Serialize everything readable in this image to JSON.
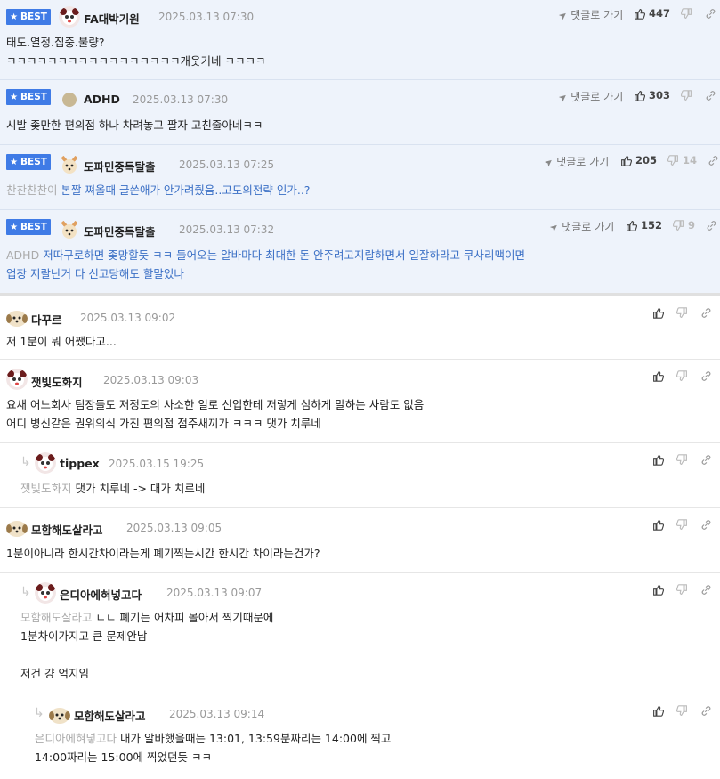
{
  "best_label": "BEST",
  "goto_label": "댓글로 가기",
  "best_comments": [
    {
      "nick": "FA대박기원",
      "date": "2025.03.13 07:30",
      "likes": "447",
      "dislikes": "",
      "lines": [
        "태도.열정.집중.불량?",
        "ㅋㅋㅋㅋㅋㅋㅋㅋㅋㅋㅋㅋㅋㅋㅋㅋㅋ개웃기네 ㅋㅋㅋㅋ"
      ]
    },
    {
      "nick": "ADHD",
      "date": "2025.03.13 07:30",
      "likes": "303",
      "dislikes": "",
      "lines": [
        "시발 좆만한 편의점 하나 차려놓고 팔자 고친줄아네ㅋㅋ"
      ]
    },
    {
      "nick": "도파민중독탈출",
      "date": "2025.03.13 07:25",
      "likes": "205",
      "dislikes": "14",
      "ref": "찬찬찬찬이",
      "lines": [
        "본짤 쪄올때 글쓴애가 안가려줬음..고도의전략 인가..?"
      ]
    },
    {
      "nick": "도파민중독탈출",
      "date": "2025.03.13 07:32",
      "likes": "152",
      "dislikes": "9",
      "ref": "ADHD",
      "lines": [
        "저따구로하면 좆망할듯 ㅋㅋ 들어오는 알바마다 최대한 돈 안주려고지랄하면서 일잘하라고 쿠사리맥이면",
        "업장 지랄난거 다 신고당해도 할말있나"
      ]
    }
  ],
  "comments": [
    {
      "nick": "다꾸르",
      "date": "2025.03.13 09:02",
      "lines": [
        "저 1분이 뭐 어쨌다고..."
      ]
    },
    {
      "nick": "잿빛도화지",
      "date": "2025.03.13 09:03",
      "lines": [
        "요새 어느회사 팀장들도 저정도의 사소한 일로 신입한테 저렇게 심하게 말하는 사람도 없음",
        "어디 병신같은 권위의식 가진 편의점 점주새끼가 ㅋㅋㅋ 댓가 치루네"
      ]
    },
    {
      "nick": "tippex",
      "date": "2025.03.15 19:25",
      "ref": "잿빛도화지",
      "lines": [
        "댓가 치루네 -> 대가 치르네"
      ]
    },
    {
      "nick": "모함해도살라고",
      "date": "2025.03.13 09:05",
      "lines": [
        "1분이아니라 한시간차이라는게 폐기찍는시간 한시간 차이라는건가?"
      ]
    },
    {
      "nick": "은디아에혀넣고다",
      "date": "2025.03.13 09:07",
      "ref": "모함해도살라고",
      "lines": [
        "ㄴㄴ 폐기는 어차피 몰아서 찍기때문에",
        "1분차이가지고 큰 문제안남",
        "",
        "저건 걍 억지임"
      ]
    },
    {
      "nick": "모함해도살라고",
      "date": "2025.03.13 09:14",
      "ref": "은디아에혀넣고다",
      "lines": [
        "내가 알바했을때는 13:01, 13:59분짜리는 14:00에 찍고",
        "14:00짜리는 15:00에 찍었던듯 ㅋㅋ"
      ]
    }
  ],
  "icons": {
    "like": "thumbs-up-icon",
    "dislike": "thumbs-down-icon",
    "link": "link-icon",
    "goto": "paper-plane-icon",
    "reply": "reply-arrow-icon",
    "best": "star-icon"
  },
  "colors": {
    "best_bg": "#eef3fb",
    "badge": "#3f7be6",
    "ref_text": "#aaaaaa",
    "reply_text": "#3a6fc5"
  }
}
